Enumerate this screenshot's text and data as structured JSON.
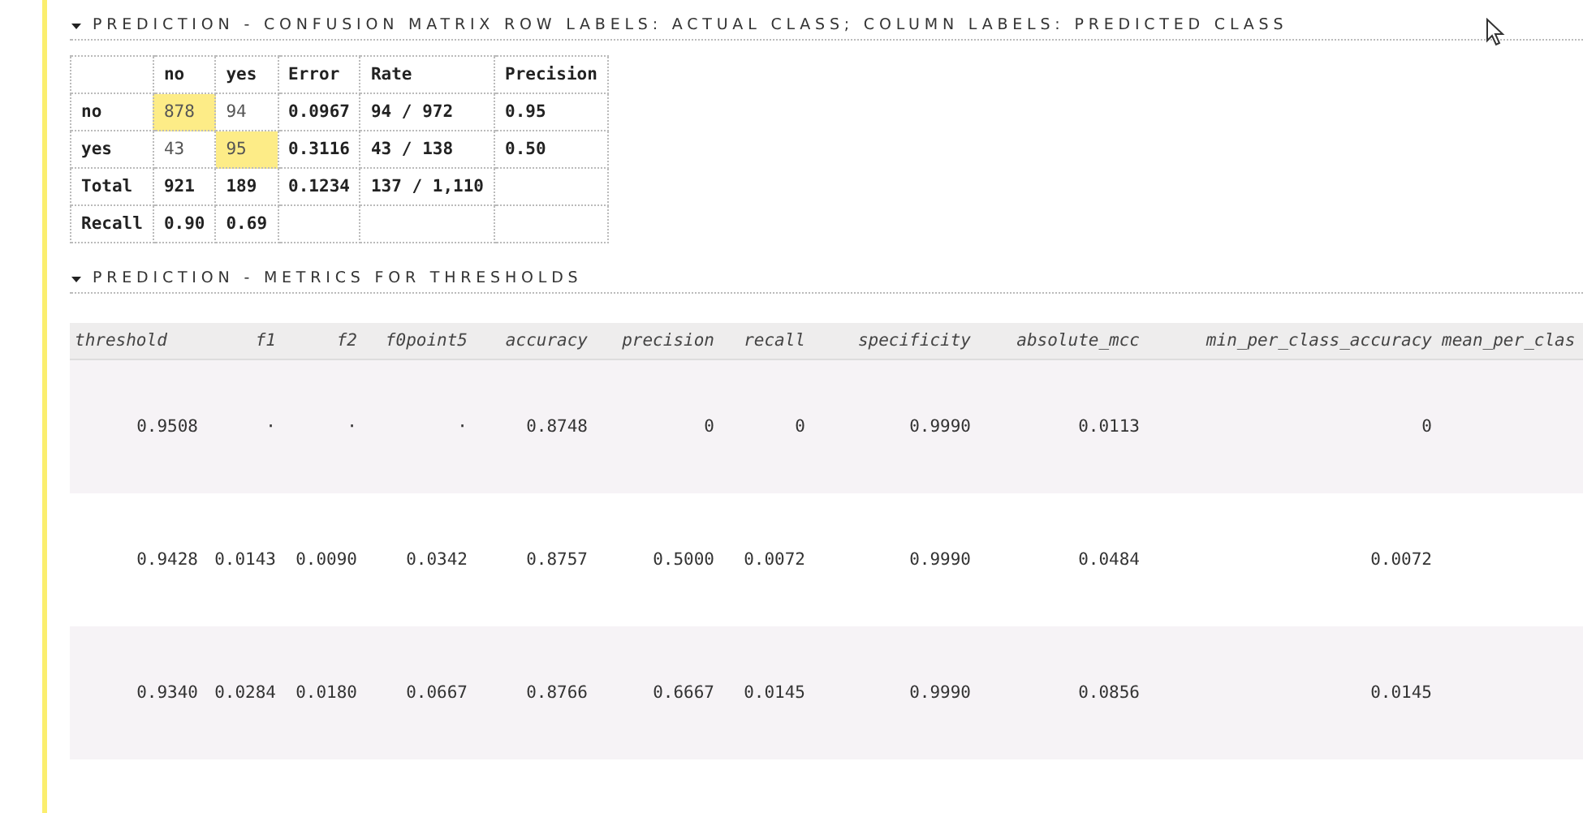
{
  "confusion_matrix": {
    "title": "PREDICTION - CONFUSION MATRIX ROW LABELS: ACTUAL CLASS; COLUMN LABELS: PREDICTED CLASS",
    "expanded": true,
    "columns": [
      "",
      "no",
      "yes",
      "Error",
      "Rate",
      "Precision"
    ],
    "rows": [
      {
        "cells": [
          {
            "text": "no",
            "highlight": false
          },
          {
            "text": "878",
            "highlight": true
          },
          {
            "text": "94",
            "highlight": false
          },
          {
            "text": "0.0967",
            "highlight": false
          },
          {
            "text": "94 / 972",
            "highlight": false
          },
          {
            "text": "0.95",
            "highlight": false
          }
        ]
      },
      {
        "cells": [
          {
            "text": "yes",
            "highlight": false
          },
          {
            "text": "43",
            "highlight": false
          },
          {
            "text": "95",
            "highlight": true
          },
          {
            "text": "0.3116",
            "highlight": false
          },
          {
            "text": "43 / 138",
            "highlight": false
          },
          {
            "text": "0.50",
            "highlight": false
          }
        ]
      },
      {
        "cells": [
          {
            "text": "Total",
            "highlight": false
          },
          {
            "text": "921",
            "highlight": false
          },
          {
            "text": "189",
            "highlight": false
          },
          {
            "text": "0.1234",
            "highlight": false
          },
          {
            "text": "137 / 1,110",
            "highlight": false
          },
          {
            "text": "",
            "highlight": false
          }
        ]
      },
      {
        "cells": [
          {
            "text": "Recall",
            "highlight": false
          },
          {
            "text": "0.90",
            "highlight": false
          },
          {
            "text": "0.69",
            "highlight": false
          },
          {
            "text": "",
            "highlight": false
          },
          {
            "text": "",
            "highlight": false
          },
          {
            "text": "",
            "highlight": false
          }
        ]
      }
    ]
  },
  "metrics": {
    "title": "PREDICTION - METRICS FOR THRESHOLDS",
    "expanded": true,
    "columns": [
      "threshold",
      "f1",
      "f2",
      "f0point5",
      "accuracy",
      "precision",
      "recall",
      "specificity",
      "absolute_mcc",
      "min_per_class_accuracy",
      "mean_per_clas"
    ],
    "rows": [
      [
        "0.9508",
        "·",
        "·",
        "·",
        "0.8748",
        "0",
        "0",
        "0.9990",
        "0.0113",
        "0",
        ""
      ],
      [
        "0.9428",
        "0.0143",
        "0.0090",
        "0.0342",
        "0.8757",
        "0.5000",
        "0.0072",
        "0.9990",
        "0.0484",
        "0.0072",
        ""
      ],
      [
        "0.9340",
        "0.0284",
        "0.0180",
        "0.0667",
        "0.8766",
        "0.6667",
        "0.0145",
        "0.9990",
        "0.0856",
        "0.0145",
        ""
      ]
    ]
  }
}
